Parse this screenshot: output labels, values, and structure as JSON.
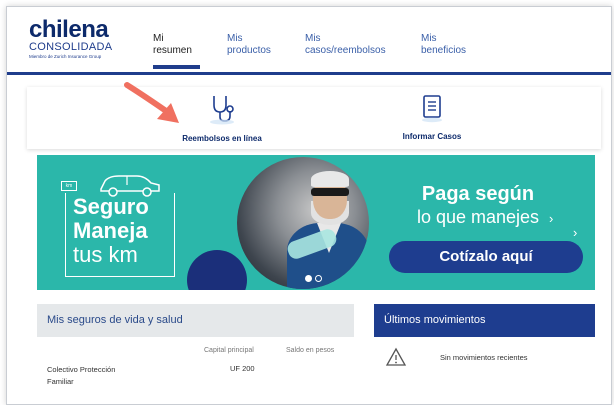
{
  "header": {
    "logo": {
      "brand": "chilena",
      "sub": "CONSOLIDADA",
      "tagline": "Miembro de Zurich Insurance Group"
    },
    "nav": [
      {
        "line1": "Mi",
        "line2": "resumen"
      },
      {
        "line1": "Mis",
        "line2": "productos"
      },
      {
        "line1": "Mis",
        "line2": "casos/reembolsos"
      },
      {
        "line1": "Mis",
        "line2": "beneficios"
      }
    ]
  },
  "quick_actions": {
    "reembolsos": "Reembolsos en línea",
    "informar": "Informar Casos"
  },
  "banner": {
    "title_lines": [
      "Seguro",
      "Maneja",
      "tus km"
    ],
    "badge": "km",
    "headline": "Paga según",
    "subheadline": "lo que manejes",
    "cta": "Cotízalo aquí",
    "slides": 2,
    "active_slide": 1
  },
  "seguros": {
    "title": "Mis seguros de vida y salud",
    "columns": [
      "Capital principal",
      "Saldo en pesos"
    ],
    "rows": [
      {
        "name_lines": [
          "Colectivo Protección",
          "Familiar"
        ],
        "capital": "UF 200",
        "saldo": ""
      }
    ]
  },
  "movimientos": {
    "title": "Últimos movimientos",
    "empty": "Sin movimientos recientes"
  },
  "colors": {
    "navy": "#1e3d8f",
    "teal": "#2bb7aa",
    "arrow": "#f07060"
  }
}
